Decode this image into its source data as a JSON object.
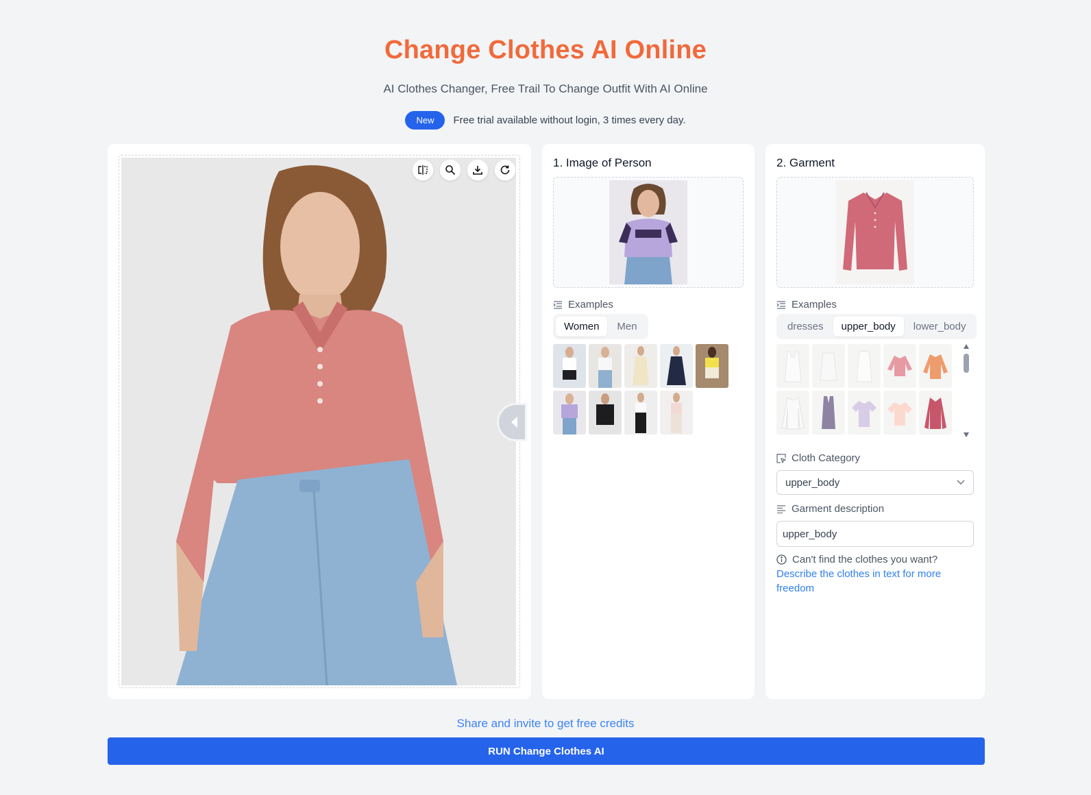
{
  "header": {
    "title": "Change Clothes AI Online",
    "subtitle": "AI Clothes Changer, Free Trail To Change Outfit With AI Online",
    "badge": "New",
    "trial_text": "Free trial available without login, 3 times every day."
  },
  "person": {
    "section_title": "1. Image of Person",
    "examples_label": "Examples",
    "tabs": [
      "Women",
      "Men"
    ],
    "active_tab": "Women"
  },
  "garment": {
    "section_title": "2. Garment",
    "examples_label": "Examples",
    "tabs": [
      "dresses",
      "upper_body",
      "lower_body"
    ],
    "active_tab": "upper_body",
    "cloth_category_label": "Cloth Category",
    "cloth_category_value": "upper_body",
    "description_label": "Garment description",
    "description_value": "upper_body",
    "hint_question": "Can't find the clothes you want?",
    "hint_link": "Describe the clothes in text for more freedom"
  },
  "footer": {
    "share_text": "Share and invite to get free credits",
    "run_label": "RUN Change Clothes AI"
  },
  "colors": {
    "title": "#f06a3b",
    "primary": "#2563eb",
    "link": "#2f80ed"
  }
}
